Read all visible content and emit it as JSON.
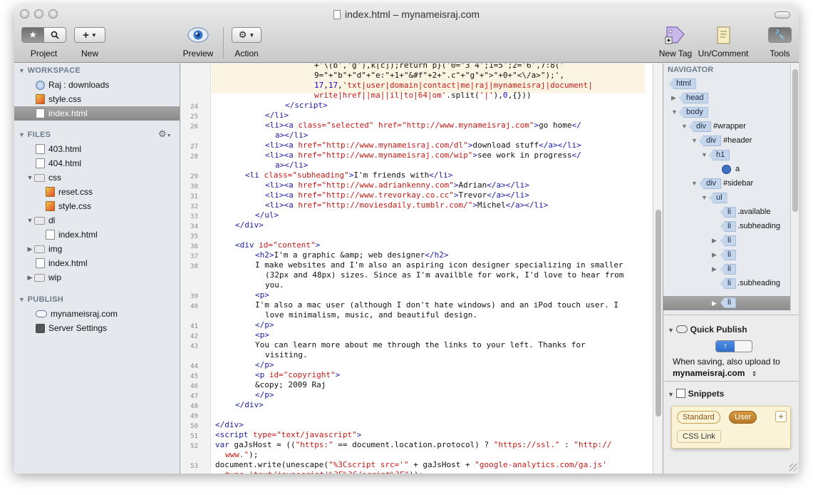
{
  "window": {
    "title": "index.html – mynameisraj.com"
  },
  "toolbar": {
    "project_label": "Project",
    "new_label": "New",
    "new_plus": "+",
    "preview_label": "Preview",
    "action_label": "Action",
    "new_tag_label": "New Tag",
    "uncomment_label": "Un/Comment",
    "tools_label": "Tools"
  },
  "sidebar": {
    "workspace_header": "WORKSPACE",
    "workspace_items": [
      "Raj : downloads",
      "style.css",
      "index.html"
    ],
    "files_header": "FILES",
    "files": [
      "403.html",
      "404.html",
      "css",
      "reset.css",
      "style.css",
      "dl",
      "index.html",
      "img",
      "index.html",
      "wip"
    ],
    "publish_header": "PUBLISH",
    "publish_items": [
      "mynameisraj.com",
      "Server Settings"
    ]
  },
  "editor": {
    "line_numbers": [
      "24",
      "25",
      "26",
      "27",
      "28",
      "29",
      "30",
      "31",
      "32",
      "33",
      "34",
      "35",
      "36",
      "37",
      "38",
      "39",
      "40",
      "41",
      "42",
      "43",
      "44",
      "45",
      "46",
      "47",
      "48",
      "49",
      "50",
      "51",
      "52",
      "53"
    ]
  },
  "navigator": {
    "header": "NAVIGATOR",
    "nodes": [
      "html",
      "head",
      "body",
      "div",
      "#wrapper",
      "div",
      "#header",
      "h1",
      "a",
      "div",
      "#sidebar",
      "ul",
      "li",
      ".available",
      "li",
      ".subheading",
      "li",
      "li",
      "li",
      "li",
      ".subheading",
      "li"
    ]
  },
  "quick_publish": {
    "title": "Quick Publish",
    "description": "When saving, also upload to",
    "server": "mynameisraj.com"
  },
  "snippets": {
    "title": "Snippets",
    "tabs": [
      "Standard",
      "User"
    ],
    "add": "+",
    "items": [
      "CSS Link"
    ]
  }
}
